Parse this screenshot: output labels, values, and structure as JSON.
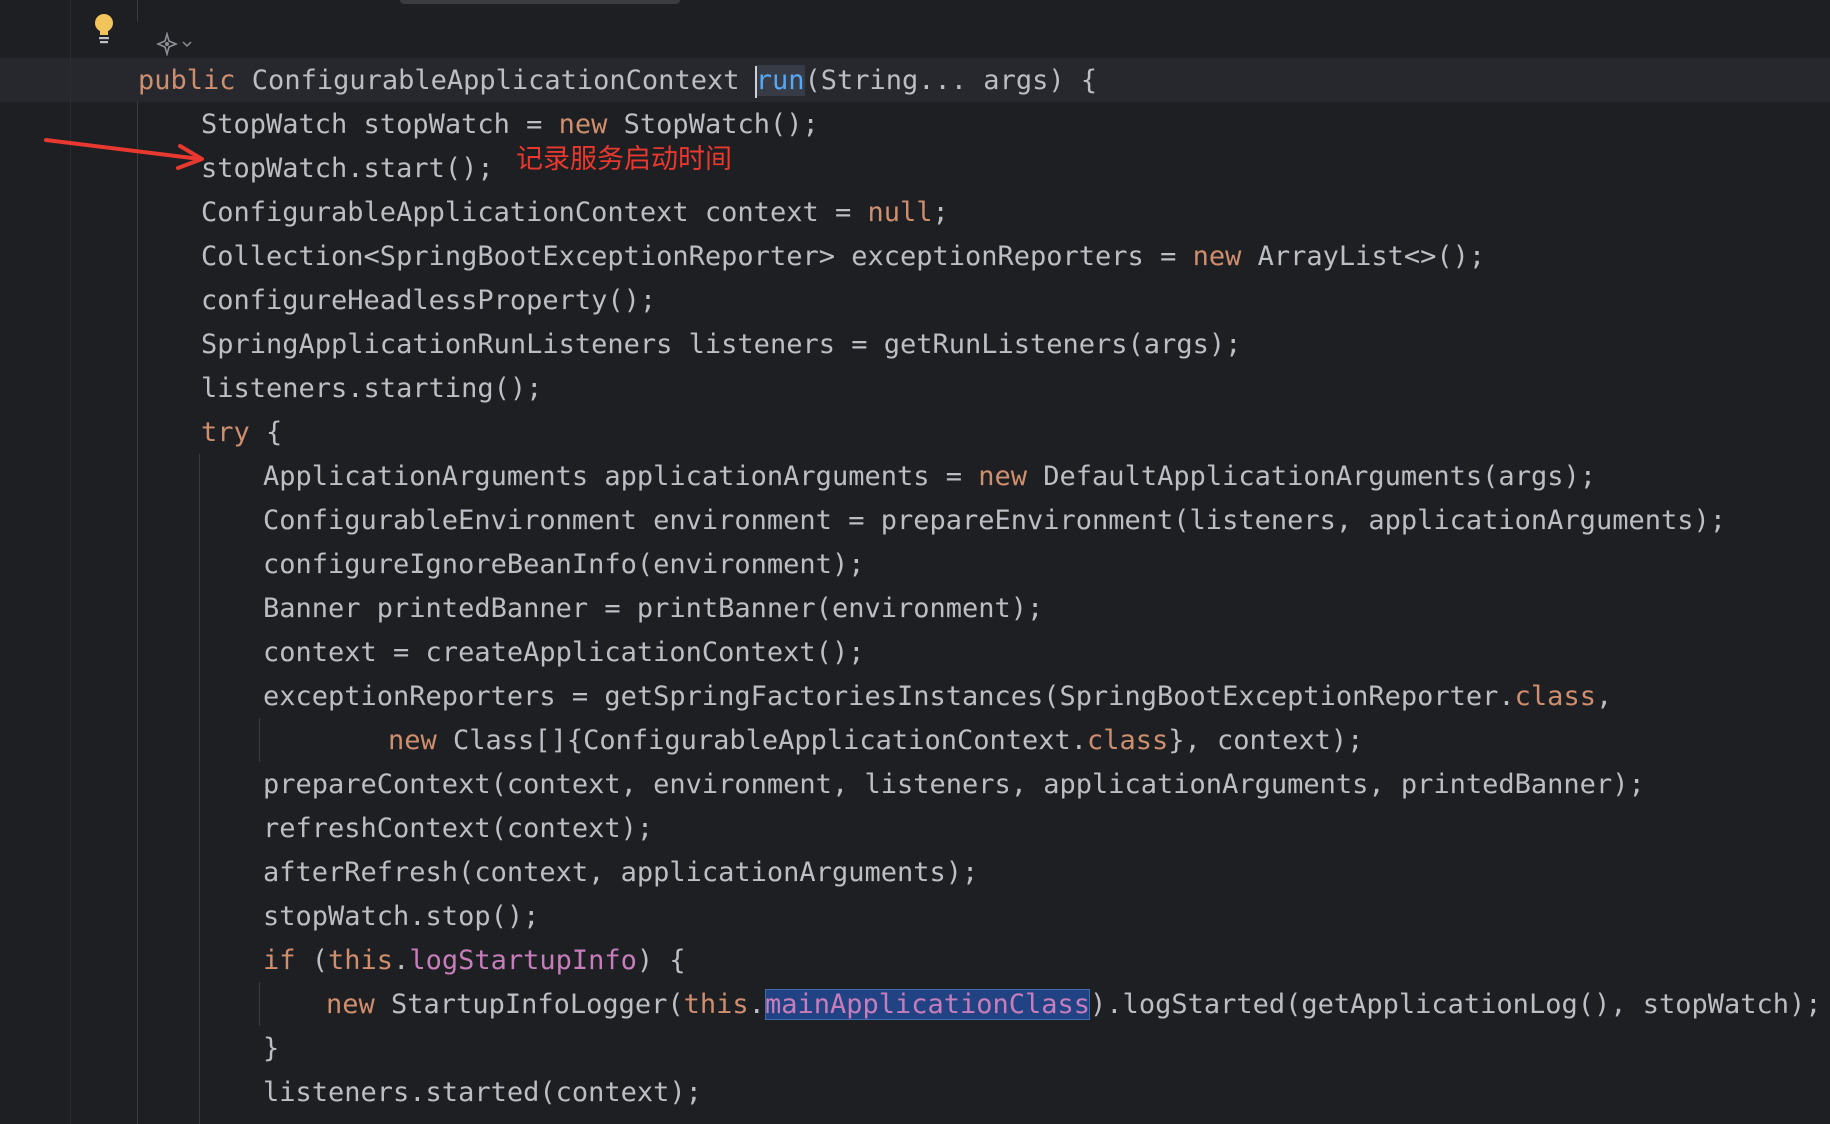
{
  "editor": {
    "lines": [
      {
        "segments": [
          {
            "t": "public",
            "c": "kw"
          },
          {
            "t": " ConfigurableApplicationContext "
          },
          {
            "t": "",
            "c": "caret"
          },
          {
            "t": "run",
            "c": "call hl-usage"
          },
          {
            "t": "(String... args) {"
          }
        ]
      },
      {
        "segments": [
          {
            "t": "StopWatch stopWatch = "
          },
          {
            "t": "new",
            "c": "kw"
          },
          {
            "t": " StopWatch();"
          }
        ]
      },
      {
        "segments": [
          {
            "t": "stopWatch.start();"
          }
        ]
      },
      {
        "segments": [
          {
            "t": "ConfigurableApplicationContext context = "
          },
          {
            "t": "null",
            "c": "kw"
          },
          {
            "t": ";"
          }
        ]
      },
      {
        "segments": [
          {
            "t": "Collection<SpringBootExceptionReporter> exceptionReporters = "
          },
          {
            "t": "new",
            "c": "kw"
          },
          {
            "t": " ArrayList<>();"
          }
        ]
      },
      {
        "segments": [
          {
            "t": "configureHeadlessProperty();"
          }
        ]
      },
      {
        "segments": [
          {
            "t": "SpringApplicationRunListeners listeners = getRunListeners(args);"
          }
        ]
      },
      {
        "segments": [
          {
            "t": "listeners.starting();"
          }
        ]
      },
      {
        "segments": [
          {
            "t": "try",
            "c": "kw"
          },
          {
            "t": " {"
          }
        ]
      },
      {
        "segments": [
          {
            "t": "ApplicationArguments applicationArguments = "
          },
          {
            "t": "new",
            "c": "kw"
          },
          {
            "t": " DefaultApplicationArguments(args);"
          }
        ]
      },
      {
        "segments": [
          {
            "t": "ConfigurableEnvironment environment = prepareEnvironment(listeners, applicationArguments);"
          }
        ]
      },
      {
        "segments": [
          {
            "t": "configureIgnoreBeanInfo(environment);"
          }
        ]
      },
      {
        "segments": [
          {
            "t": "Banner printedBanner = printBanner(environment);"
          }
        ]
      },
      {
        "segments": [
          {
            "t": "context = createApplicationContext();"
          }
        ]
      },
      {
        "segments": [
          {
            "t": "exceptionReporters = getSpringFactoriesInstances(SpringBootExceptionReporter."
          },
          {
            "t": "class",
            "c": "kw"
          },
          {
            "t": ","
          }
        ]
      },
      {
        "segments": [
          {
            "t": "new",
            "c": "kw"
          },
          {
            "t": " Class[]{ConfigurableApplicationContext."
          },
          {
            "t": "class",
            "c": "kw"
          },
          {
            "t": "}, context);"
          }
        ]
      },
      {
        "segments": [
          {
            "t": "prepareContext(context, environment, listeners, applicationArguments, printedBanner);"
          }
        ]
      },
      {
        "segments": [
          {
            "t": "refreshContext(context);"
          }
        ]
      },
      {
        "segments": [
          {
            "t": "afterRefresh(context, applicationArguments);"
          }
        ]
      },
      {
        "segments": [
          {
            "t": "stopWatch.stop();"
          }
        ]
      },
      {
        "segments": [
          {
            "t": "if",
            "c": "kw"
          },
          {
            "t": " ("
          },
          {
            "t": "this",
            "c": "kw"
          },
          {
            "t": "."
          },
          {
            "t": "logStartupInfo",
            "c": "fld"
          },
          {
            "t": ") {"
          }
        ]
      },
      {
        "segments": [
          {
            "t": "new",
            "c": "kw"
          },
          {
            "t": " StartupInfoLogger("
          },
          {
            "t": "this",
            "c": "kw"
          },
          {
            "t": "."
          },
          {
            "t": "mainApplicationClass",
            "c": "fld hl-box"
          },
          {
            "t": ").logStarted(getApplicationLog(), stopWatch);"
          }
        ]
      },
      {
        "segments": [
          {
            "t": "}"
          }
        ]
      },
      {
        "segments": [
          {
            "t": "listeners.started(context);"
          }
        ]
      }
    ]
  },
  "annotation": {
    "text": "记录服务启动时间",
    "color": "#e8382f"
  },
  "icons": {
    "intention": "lightbulb-icon",
    "inlay": "ai-sparkle-icon"
  },
  "colors": {
    "background": "#1e1f22",
    "text": "#bcbec4",
    "keyword": "#cf8e6d",
    "field": "#c77dbb",
    "method_declaration": "#56a8f5"
  }
}
